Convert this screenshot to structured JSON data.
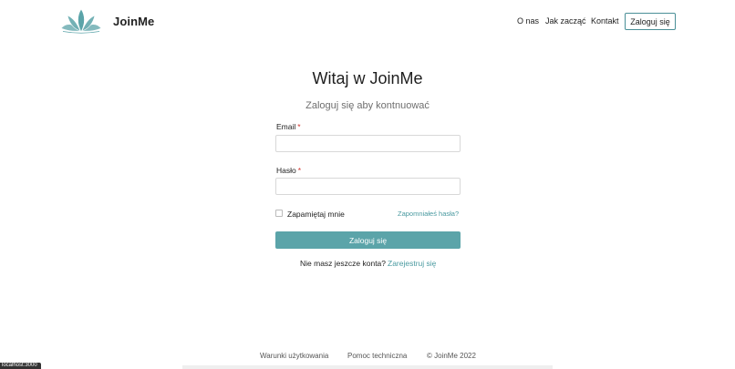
{
  "header": {
    "brand": "JoinMe",
    "nav": {
      "about": "O nas",
      "how_to_start": "Jak zacząć",
      "contact": "Kontakt"
    },
    "login_button": "Zaloguj się",
    "logo_icon": "lotus-icon",
    "logo_color": "#5ba4a9"
  },
  "main": {
    "title": "Witaj w JoinMe",
    "subtitle": "Zaloguj się aby kontnuować",
    "email_label": "Email",
    "password_label": "Hasło",
    "required_mark": "*",
    "email_value": "",
    "password_value": "",
    "remember_label": "Zapamiętaj mnie",
    "forgot_link": "Zapomniałeś hasła?",
    "submit": "Zaloguj się",
    "no_account": "Nie masz jeszcze konta?",
    "register_link": "Zarejestruj się"
  },
  "footer": {
    "terms": "Warunki użytkowania",
    "help": "Pomoc techniczna",
    "copyright": "© JoinMe 2022"
  },
  "status_bar": "localhost:3000",
  "colors": {
    "accent": "#5ba4a9",
    "link": "#4a9aa0",
    "required": "#d3352f"
  }
}
